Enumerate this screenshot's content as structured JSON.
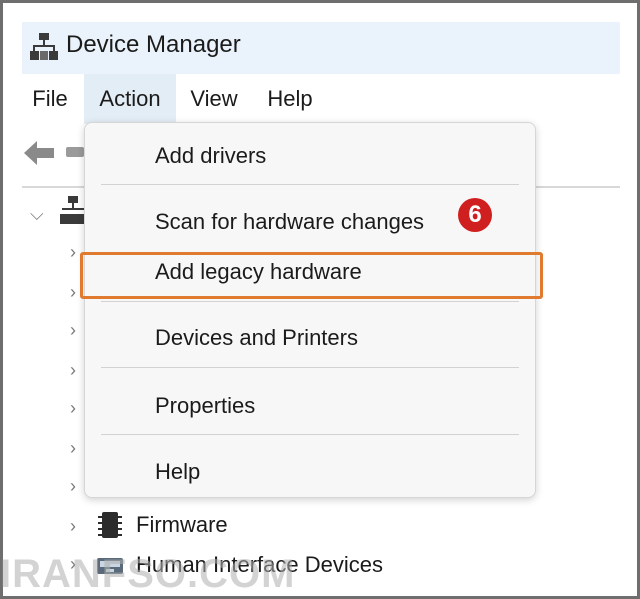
{
  "window": {
    "title": "Device Manager"
  },
  "menubar": {
    "items": [
      {
        "label": "File"
      },
      {
        "label": "Action"
      },
      {
        "label": "View"
      },
      {
        "label": "Help"
      }
    ],
    "active": "Action"
  },
  "action_menu": {
    "items": [
      {
        "label": "Add drivers"
      },
      {
        "label": "Scan for hardware changes"
      },
      {
        "label": "Add legacy hardware",
        "highlighted": true
      },
      {
        "label": "Devices and Printers"
      },
      {
        "label": "Properties"
      },
      {
        "label": "Help"
      }
    ]
  },
  "annotation": {
    "step_number": "6",
    "highlight_color": "#e07a2e",
    "badge_color": "#d01f1f"
  },
  "tree": {
    "visible_items": [
      {
        "label": "Firmware",
        "icon": "firmware-chip-icon"
      },
      {
        "label": "Human Interface Devices",
        "icon": "hid-device-icon"
      }
    ]
  },
  "watermark": {
    "text": "IRANFSO.COM"
  }
}
